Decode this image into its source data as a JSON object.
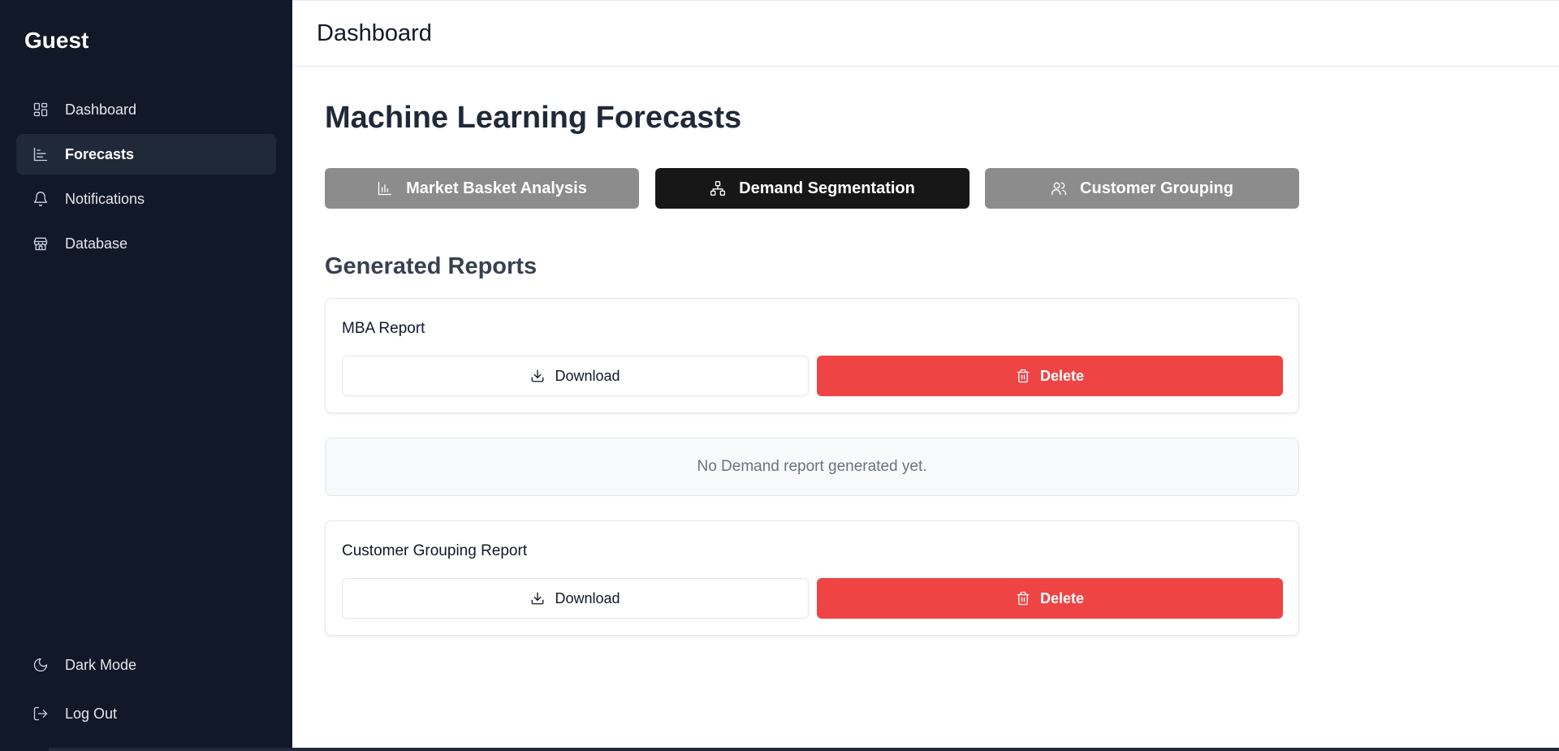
{
  "sidebar": {
    "brand": "Guest",
    "items": [
      {
        "label": "Dashboard",
        "icon": "dashboard-grid-icon"
      },
      {
        "label": "Forecasts",
        "icon": "chart-icon",
        "active": true
      },
      {
        "label": "Notifications",
        "icon": "bell-icon"
      },
      {
        "label": "Database",
        "icon": "store-icon"
      }
    ],
    "bottom": [
      {
        "label": "Dark Mode",
        "icon": "moon-icon"
      },
      {
        "label": "Log Out",
        "icon": "logout-icon"
      }
    ]
  },
  "header": {
    "title": "Dashboard"
  },
  "main": {
    "title": "Machine Learning Forecasts",
    "tabs": [
      {
        "label": "Market Basket Analysis",
        "icon": "bar-chart-icon"
      },
      {
        "label": "Demand Segmentation",
        "icon": "network-icon",
        "active": true
      },
      {
        "label": "Customer Grouping",
        "icon": "users-icon"
      }
    ],
    "section_title": "Generated Reports",
    "reports": [
      {
        "title": "MBA Report",
        "download_label": "Download",
        "delete_label": "Delete"
      },
      {
        "empty_message": "No Demand report generated yet."
      },
      {
        "title": "Customer Grouping Report",
        "download_label": "Download",
        "delete_label": "Delete"
      }
    ]
  },
  "colors": {
    "sidebar_bg": "#111827",
    "active_tab": "#171717",
    "inactive_tab": "#8c8c8c",
    "delete": "#ef4444"
  }
}
